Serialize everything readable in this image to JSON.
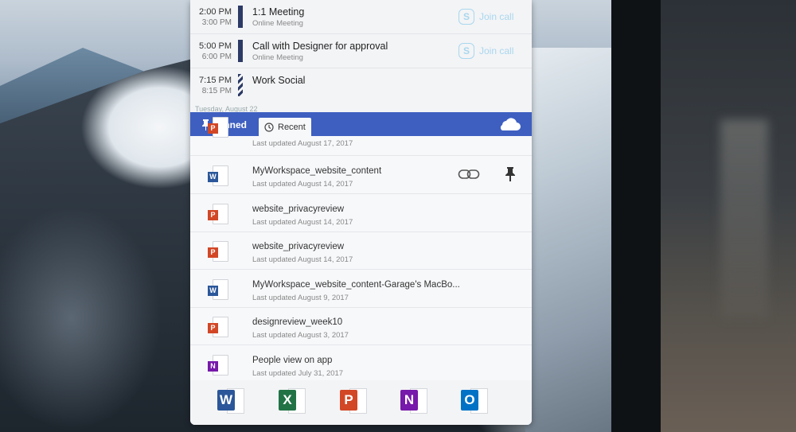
{
  "calendar": {
    "events": [
      {
        "start": "2:00 PM",
        "end": "3:00 PM",
        "title": "1:1 Meeting",
        "subtitle": "Online Meeting",
        "join_label": "Join call",
        "style": "solid"
      },
      {
        "start": "5:00 PM",
        "end": "6:00 PM",
        "title": "Call with Designer for approval",
        "subtitle": "Online Meeting",
        "join_label": "Join call",
        "style": "solid"
      },
      {
        "start": "7:15 PM",
        "end": "8:15 PM",
        "title": "Work Social",
        "subtitle": "",
        "join_label": "",
        "style": "hatched"
      }
    ],
    "next_day_header": "Tuesday, August 22"
  },
  "tabs": {
    "pinned_label": "Pinned",
    "recent_label": "Recent",
    "cloud_icon": "onedrive-cloud-icon"
  },
  "files": [
    {
      "name": "",
      "meta": "Last updated August 17, 2017",
      "app": "powerpoint"
    },
    {
      "name": "MyWorkspace_website_content",
      "meta": "Last updated August 14, 2017",
      "app": "word"
    },
    {
      "name": "website_privacyreview",
      "meta": "Last updated August 14, 2017",
      "app": "powerpoint"
    },
    {
      "name": "website_privacyreview",
      "meta": "Last updated August 14, 2017",
      "app": "powerpoint"
    },
    {
      "name": "MyWorkspace_website_content-Garage's MacBo...",
      "meta": "Last updated August 9, 2017",
      "app": "word"
    },
    {
      "name": "designreview_week10",
      "meta": "Last updated August 3, 2017",
      "app": "powerpoint"
    },
    {
      "name": "People view on app",
      "meta": "Last updated July 31, 2017",
      "app": "onenote"
    }
  ],
  "apps": [
    {
      "name": "word",
      "letter": "W",
      "color": "#2b579a"
    },
    {
      "name": "excel",
      "letter": "X",
      "color": "#217346"
    },
    {
      "name": "powerpoint",
      "letter": "P",
      "color": "#d24726"
    },
    {
      "name": "onenote",
      "letter": "N",
      "color": "#7719aa"
    },
    {
      "name": "outlook",
      "letter": "O",
      "color": "#0072c6"
    }
  ],
  "colors": {
    "accent": "#3e5fc0",
    "event_bar": "#2c3a66",
    "skype": "#a9d7ee"
  }
}
